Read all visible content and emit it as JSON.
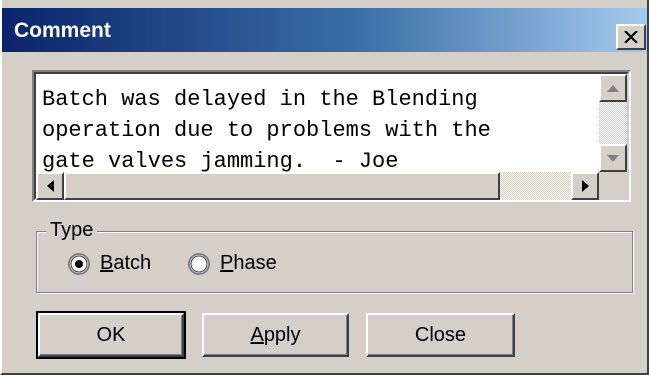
{
  "window": {
    "title": "Comment",
    "close_glyph": "close-icon"
  },
  "memo": {
    "lines": [
      "Batch was delayed in the Blending",
      "operation due to problems with the",
      "gate valves jamming.  - Joe"
    ]
  },
  "type_group": {
    "label": "Type",
    "options": [
      {
        "prefix": "",
        "accel": "B",
        "rest": "atch",
        "selected": true
      },
      {
        "prefix": "",
        "accel": "P",
        "rest": "hase",
        "selected": false
      }
    ]
  },
  "buttons": {
    "ok": {
      "prefix": "OK",
      "accel": "",
      "rest": ""
    },
    "apply": {
      "prefix": "",
      "accel": "A",
      "rest": "pply"
    },
    "close": {
      "prefix": "Close",
      "accel": "",
      "rest": ""
    }
  },
  "colors": {
    "titlebar_start": "#0a246a",
    "titlebar_end": "#a6caf0",
    "face": "#d4d0c8"
  }
}
